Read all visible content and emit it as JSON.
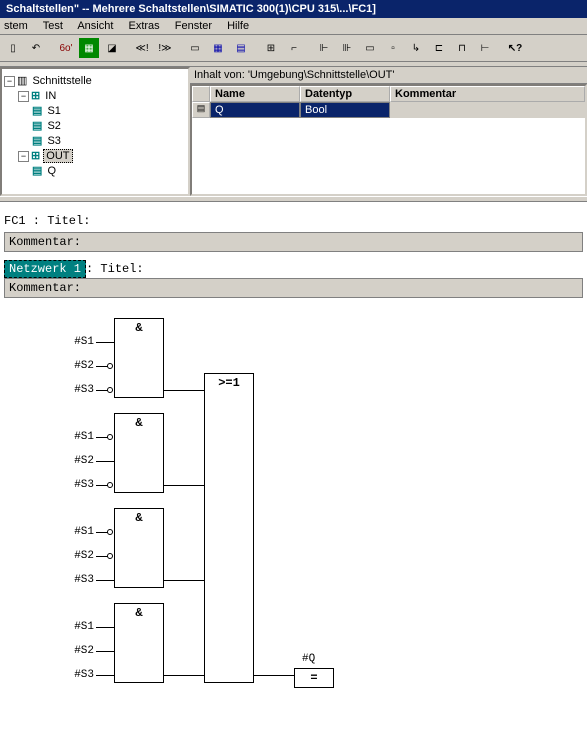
{
  "window": {
    "title": "Schaltstellen\" -- Mehrere Schaltstellen\\SIMATIC 300(1)\\CPU 315\\...\\FC1]"
  },
  "menu": {
    "items": [
      "stem",
      "Test",
      "Ansicht",
      "Extras",
      "Fenster",
      "Hilfe"
    ]
  },
  "pathbar": {
    "label": "Inhalt von:",
    "path": "'Umgebung\\Schnittstelle\\OUT'"
  },
  "table": {
    "headers": [
      "",
      "Name",
      "Datentyp",
      "Kommentar"
    ],
    "rows": [
      {
        "icon": "▤",
        "name": "Q",
        "type": "Bool",
        "comment": ""
      }
    ]
  },
  "tree": {
    "root": "Schnittstelle",
    "in": {
      "label": "IN",
      "items": [
        "S1",
        "S2",
        "S3"
      ]
    },
    "out": {
      "label": "OUT",
      "items": [
        "Q"
      ]
    }
  },
  "code": {
    "fc_title": "FC1 : Titel:",
    "kommentar_label": "Kommentar:",
    "netzwerk": "Netzwerk 1",
    "netzwerk_title": ": Titel:"
  },
  "fbd": {
    "and_symbol": "&",
    "or_symbol": ">=1",
    "assign_symbol": "=",
    "inputs": [
      "#S1",
      "#S2",
      "#S3"
    ],
    "output": "#Q"
  }
}
